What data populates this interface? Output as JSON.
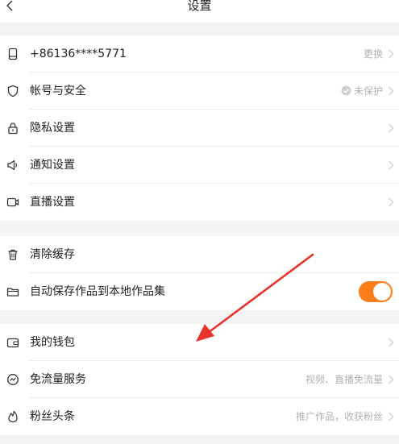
{
  "header": {
    "title": "设置",
    "back_icon": "chevron-left-icon"
  },
  "groups": [
    {
      "items": [
        {
          "icon": "phone-icon",
          "label": "+86136****5771",
          "right_text": "更换"
        },
        {
          "icon": "shield-icon",
          "label": "帐号与安全",
          "right_text": "未保护",
          "right_icon": "check-circle-icon"
        },
        {
          "icon": "lock-icon",
          "label": "隐私设置"
        },
        {
          "icon": "speaker-icon",
          "label": "通知设置"
        },
        {
          "icon": "video-camera-icon",
          "label": "直播设置"
        }
      ]
    },
    {
      "items": [
        {
          "icon": "trash-icon",
          "label": "清除缓存"
        },
        {
          "icon": "folder-icon",
          "label": "自动保存作品到本地作品集",
          "toggle": true,
          "toggle_on": true
        }
      ]
    },
    {
      "items": [
        {
          "icon": "wallet-icon",
          "label": "我的钱包"
        },
        {
          "icon": "traffic-icon",
          "label": "免流量服务",
          "right_text": "视频、直播免流量"
        },
        {
          "icon": "flame-icon",
          "label": "粉丝头条",
          "right_text": "推广作品，收获粉丝"
        }
      ]
    }
  ],
  "colors": {
    "accent": "#ff7d18",
    "annotation_arrow": "#e8322b",
    "background": "#f4f4f4",
    "secondary_text": "#b2b2b2"
  }
}
